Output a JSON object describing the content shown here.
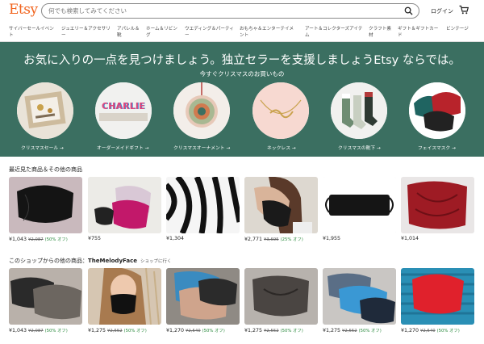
{
  "header": {
    "logo": "Etsy",
    "search_placeholder": "何でも検索してみてください",
    "signin": "ログイン"
  },
  "nav": [
    "サイバーセールイベント",
    "ジュエリー＆アクセサリー",
    "アパレル＆靴",
    "ホーム＆リビング",
    "ウエディング＆パーティー",
    "おもちゃ＆エンターテイメント",
    "アート＆コレクターズアイテム",
    "クラフト素材",
    "ギフト＆ギフトカード",
    "ビンテージ"
  ],
  "hero": {
    "title": "お気に入りの一点を見つけましょう。独立セラーを支援しましょうEtsy ならでは。",
    "subtitle": "今すぐクリスマスのお買いもの",
    "categories": [
      {
        "label": "クリスマスセール",
        "arrow": "→"
      },
      {
        "label": "オーダーメイドギフト",
        "arrow": "→",
        "badge": "CHARLIE"
      },
      {
        "label": "クリスマスオーナメント",
        "arrow": "→"
      },
      {
        "label": "ネックレス",
        "arrow": "→"
      },
      {
        "label": "クリスマスの靴下",
        "arrow": "→"
      },
      {
        "label": "フェイスマスク",
        "arrow": "→"
      }
    ]
  },
  "recent": {
    "title": "最近見た商品＆その他の商品",
    "items": [
      {
        "price": "¥1,043",
        "orig": "¥2,087",
        "disc": "(50% オフ)"
      },
      {
        "price": "¥755",
        "orig": "",
        "disc": ""
      },
      {
        "price": "¥1,304",
        "orig": "",
        "disc": ""
      },
      {
        "price": "¥2,771",
        "orig": "¥3,695",
        "disc": "(25% オフ)"
      },
      {
        "price": "¥1,955",
        "orig": "",
        "disc": ""
      },
      {
        "price": "¥1,014",
        "orig": "",
        "disc": ""
      }
    ]
  },
  "shop": {
    "prefix": "このショップからの他の商品：",
    "name": "TheMelodyFace",
    "goto": "ショップに行く",
    "items": [
      {
        "price": "¥1,043",
        "orig": "¥2,087",
        "disc": "(50% オフ)"
      },
      {
        "price": "¥1,275",
        "orig": "¥2,552",
        "disc": "(50% オフ)"
      },
      {
        "price": "¥1,270",
        "orig": "¥2,540",
        "disc": "(50% オフ)"
      },
      {
        "price": "¥1,275",
        "orig": "¥2,552",
        "disc": "(50% オフ)"
      },
      {
        "price": "¥1,275",
        "orig": "¥2,552",
        "disc": "(50% オフ)"
      },
      {
        "price": "¥1,270",
        "orig": "¥2,540",
        "disc": "(50% オフ)"
      }
    ]
  }
}
